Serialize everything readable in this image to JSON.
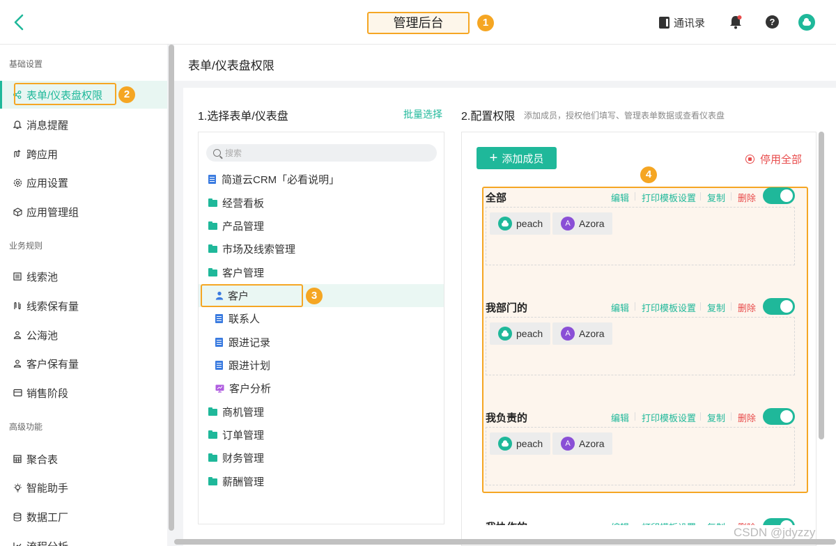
{
  "header": {
    "title": "管理后台",
    "title_marker": "1",
    "contacts_label": "通讯录"
  },
  "sidebar": {
    "groups": [
      {
        "label": "基础设置"
      },
      {
        "label": "业务规则"
      },
      {
        "label": "高级功能"
      }
    ],
    "items": [
      {
        "label": "表单/仪表盘权限",
        "icon": "share-icon",
        "active": true
      },
      {
        "label": "消息提醒",
        "icon": "bell-outline-icon"
      },
      {
        "label": "跨应用",
        "icon": "cross-app-icon"
      },
      {
        "label": "应用设置",
        "icon": "gear-icon"
      },
      {
        "label": "应用管理组",
        "icon": "cube-icon"
      },
      {
        "label": "线索池",
        "icon": "pool-icon"
      },
      {
        "label": "线索保有量",
        "icon": "retention-icon"
      },
      {
        "label": "公海池",
        "icon": "user-icon"
      },
      {
        "label": "客户保有量",
        "icon": "user-icon"
      },
      {
        "label": "销售阶段",
        "icon": "stage-icon"
      },
      {
        "label": "聚合表",
        "icon": "table-icon"
      },
      {
        "label": "智能助手",
        "icon": "bulb-icon"
      },
      {
        "label": "数据工厂",
        "icon": "database-icon"
      },
      {
        "label": "流程分析",
        "icon": "flow-icon"
      }
    ],
    "active_marker": "2"
  },
  "main": {
    "page_title": "表单/仪表盘权限",
    "section1_title": "1.选择表单/仪表盘",
    "batch_select": "批量选择",
    "section2_title": "2.配置权限",
    "section2_desc": "添加成员，授权他们填写、管理表单数据或查看仪表盘",
    "search_placeholder": "搜索",
    "tree": [
      {
        "label": "简道云CRM「必看说明」",
        "type": "doc",
        "color": "#3a7be0"
      },
      {
        "label": "经营看板",
        "type": "folder"
      },
      {
        "label": "产品管理",
        "type": "folder"
      },
      {
        "label": "市场及线索管理",
        "type": "folder"
      },
      {
        "label": "客户管理",
        "type": "folder"
      },
      {
        "label": "客户",
        "type": "form",
        "color": "#3a7be0",
        "selected": true
      },
      {
        "label": "联系人",
        "type": "form",
        "color": "#3a7be0"
      },
      {
        "label": "跟进记录",
        "type": "form",
        "color": "#3a7be0"
      },
      {
        "label": "跟进计划",
        "type": "form",
        "color": "#3a7be0"
      },
      {
        "label": "客户分析",
        "type": "dashboard",
        "color": "#b05ee0"
      },
      {
        "label": "商机管理",
        "type": "folder"
      },
      {
        "label": "订单管理",
        "type": "folder"
      },
      {
        "label": "财务管理",
        "type": "folder"
      },
      {
        "label": "薪酬管理",
        "type": "folder"
      }
    ],
    "tree_marker": "3",
    "add_member": "添加成员",
    "disable_all": "停用全部",
    "perm_marker": "4",
    "permission_groups": [
      {
        "name": "全部",
        "enabled": true,
        "members": [
          "peach",
          "Azora"
        ]
      },
      {
        "name": "我部门的",
        "enabled": true,
        "members": [
          "peach",
          "Azora"
        ]
      },
      {
        "name": "我负责的",
        "enabled": true,
        "members": [
          "peach",
          "Azora"
        ]
      },
      {
        "name": "我协作的",
        "enabled": true,
        "members": []
      }
    ],
    "actions": {
      "edit": "编辑",
      "print": "打印模板设置",
      "copy": "复制",
      "delete": "删除"
    },
    "member_avatars": {
      "peach": "cloud-avatar-icon",
      "Azora": "A"
    }
  },
  "watermark": "CSDN @jdyzzy",
  "colors": {
    "accent": "#1fb89a",
    "highlight": "#f5a623",
    "danger": "#e84c4c"
  }
}
